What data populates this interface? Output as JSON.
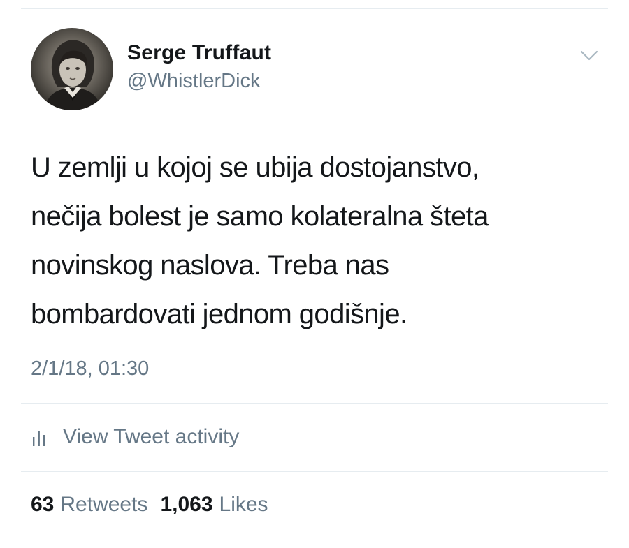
{
  "tweet": {
    "author": {
      "display_name": "Serge Truffaut",
      "handle": "@WhistlerDick",
      "avatar_icon": "avatar-portrait"
    },
    "menu_icon": "chevron-down-icon",
    "text_lines": [
      "U zemlji u kojoj se ubija dostojanstvo,",
      "nečija bolest je samo kolateralna šteta",
      "novinskog naslova. Treba nas",
      "bombardovati jednom godišnje."
    ],
    "timestamp": "2/1/18, 01:30",
    "activity": {
      "icon": "bar-chart-icon",
      "label": "View Tweet activity"
    },
    "stats": {
      "retweets_count": "63",
      "retweets_label": "Retweets",
      "likes_count": "1,063",
      "likes_label": "Likes"
    }
  },
  "colors": {
    "text_primary": "#14171a",
    "text_secondary": "#657786",
    "divider": "#e6ecf0",
    "chevron": "#aab8c2"
  }
}
